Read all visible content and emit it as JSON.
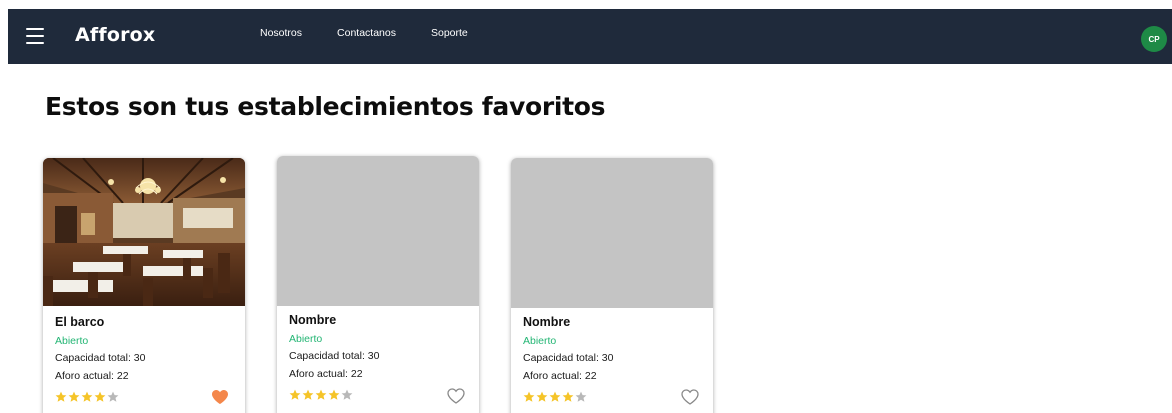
{
  "navbar": {
    "menu_icon": "hamburger-menu-icon",
    "brand": "Afforox",
    "links": [
      "Nosotros",
      "Contactanos",
      "Soporte"
    ],
    "avatar_initials": "CP",
    "background": "#1f2a3b",
    "avatar_color": "#1e8a46"
  },
  "page_title": "Estos son tus establecimientos favoritos",
  "cards": [
    {
      "image": "restaurant-interior-photo",
      "name": "El barco",
      "status": "Abierto",
      "capacity": "Capacidad total: 30",
      "current": "Aforo actual: 22",
      "rating": 4,
      "rating_max": 5,
      "favorite": true
    },
    {
      "image": "placeholder-image",
      "name": "Nombre",
      "status": "Abierto",
      "capacity": "Capacidad total: 30",
      "current": "Aforo actual: 22",
      "rating": 4,
      "rating_max": 5,
      "favorite": false
    },
    {
      "image": "placeholder-image",
      "name": "Nombre",
      "status": "Abierto",
      "capacity": "Capacidad total: 30",
      "current": "Aforo actual: 22",
      "rating": 4,
      "rating_max": 5,
      "favorite": false
    }
  ],
  "colors": {
    "status_open": "#22b573",
    "star_filled": "#f5c428",
    "star_empty": "#b8b8b8",
    "heart_filled": "#f4874b",
    "heart_outline": "#888888"
  }
}
